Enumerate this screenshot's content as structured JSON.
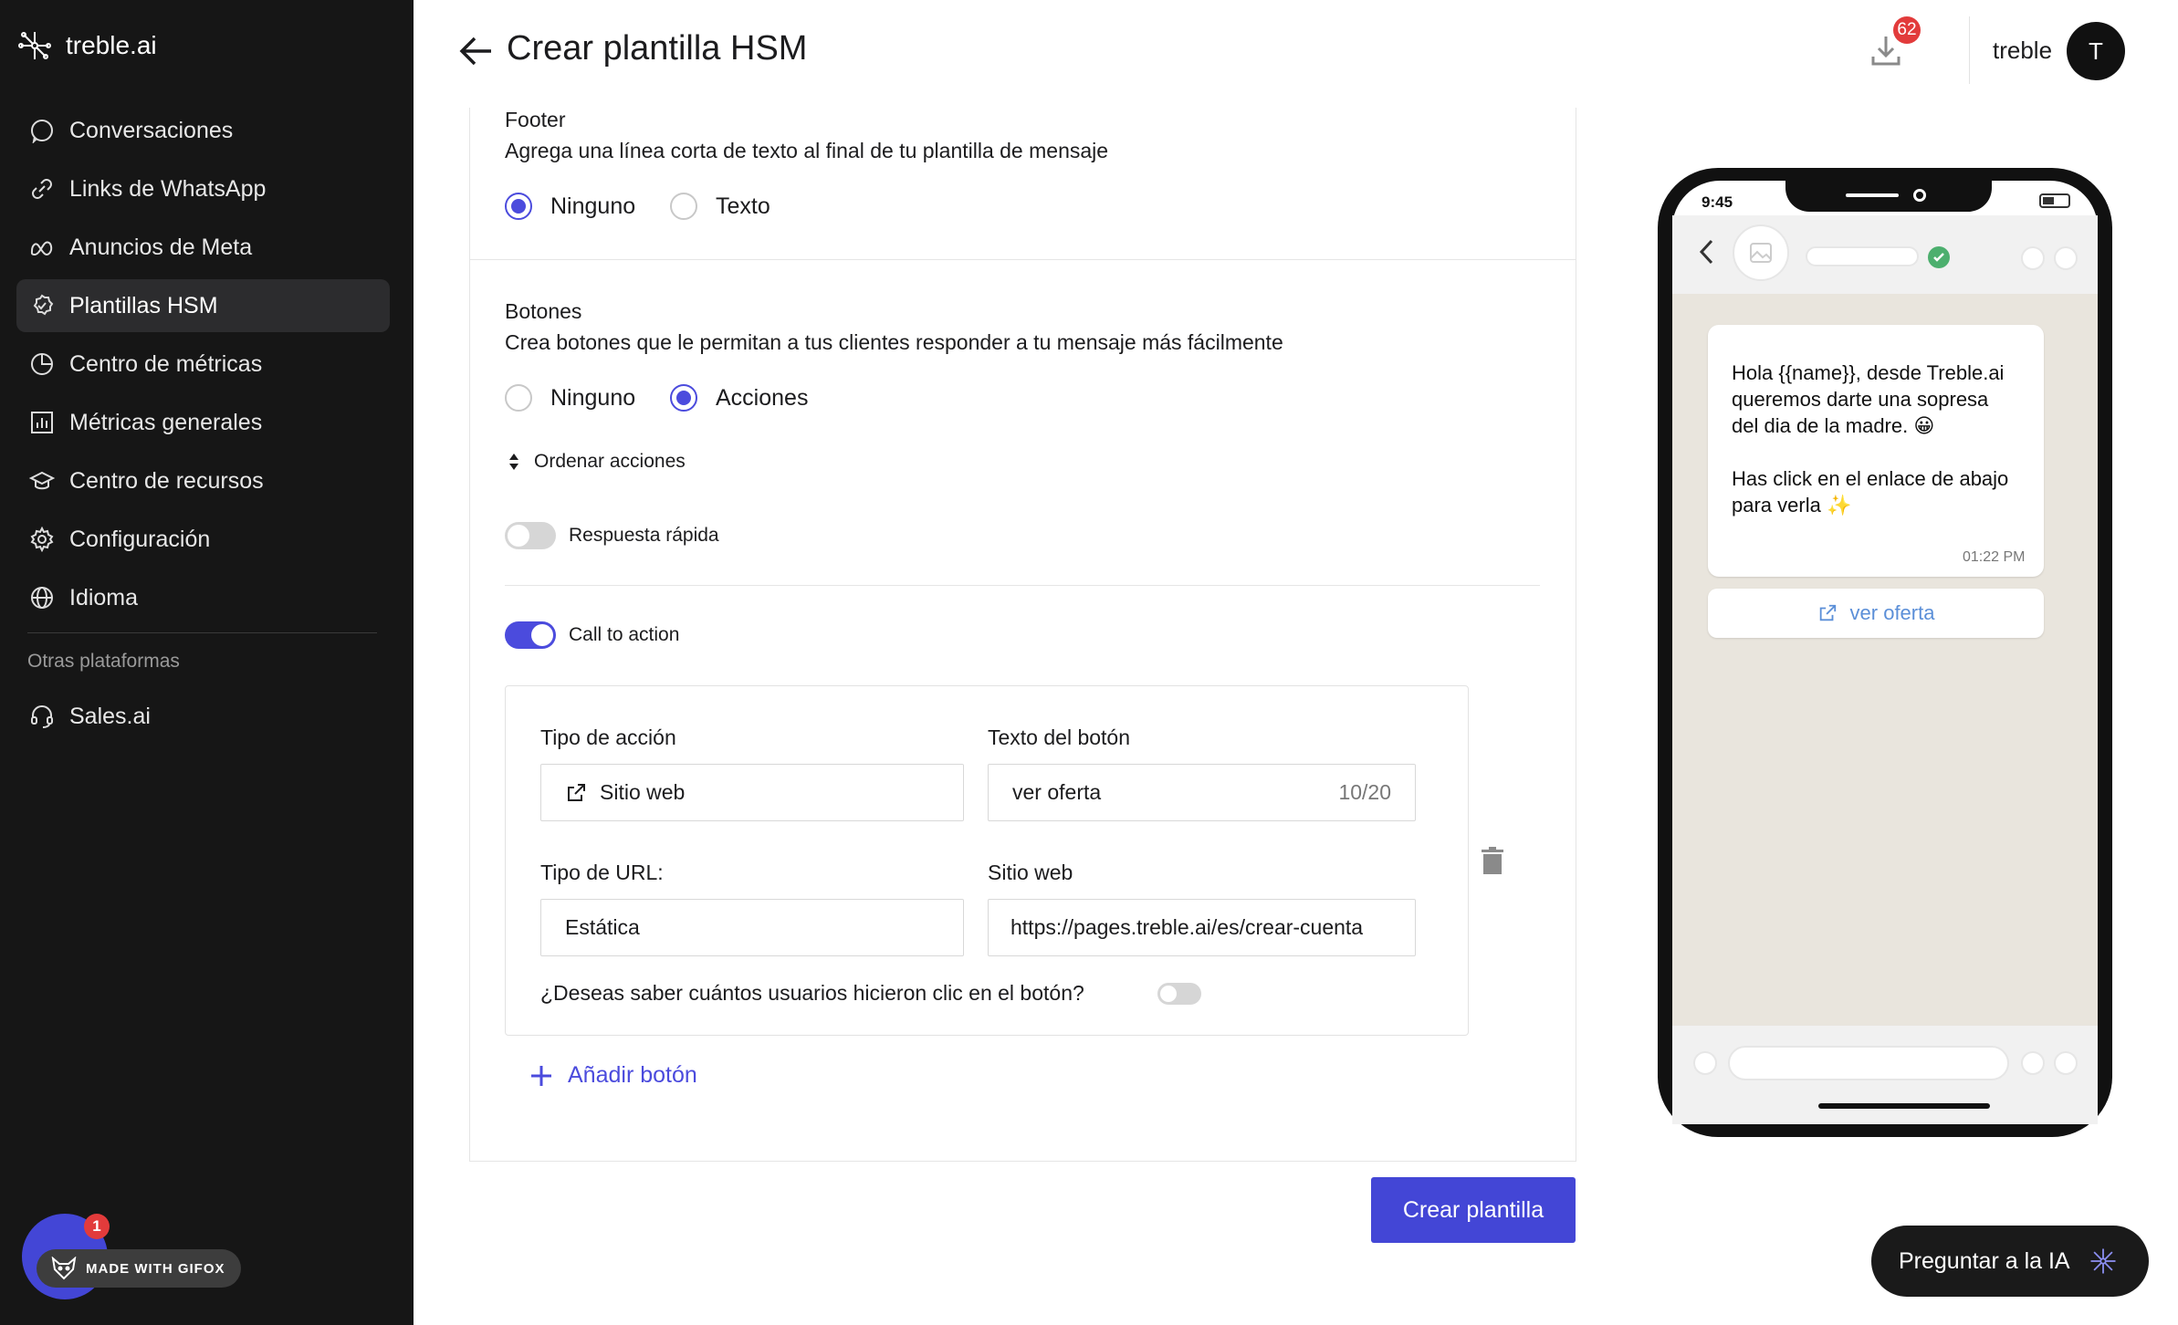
{
  "app": {
    "logo_text": "treble.ai",
    "page_title": "Crear plantilla HSM"
  },
  "header": {
    "downloads_badge": "62",
    "user_name": "treble",
    "avatar_initial": "T"
  },
  "sidebar": {
    "items": [
      {
        "label": "Conversaciones",
        "icon": "chat-icon"
      },
      {
        "label": "Links de WhatsApp",
        "icon": "link-icon"
      },
      {
        "label": "Anuncios de Meta",
        "icon": "meta-icon"
      },
      {
        "label": "Plantillas HSM",
        "icon": "template-check-icon",
        "active": true
      },
      {
        "label": "Centro de métricas",
        "icon": "pie-chart-icon"
      },
      {
        "label": "Métricas generales",
        "icon": "bar-chart-icon"
      },
      {
        "label": "Centro de recursos",
        "icon": "graduation-cap-icon"
      },
      {
        "label": "Configuración",
        "icon": "gear-icon"
      },
      {
        "label": "Idioma",
        "icon": "globe-icon"
      }
    ],
    "section_label": "Otras plataformas",
    "other_items": [
      {
        "label": "Sales.ai",
        "icon": "headset-icon"
      }
    ]
  },
  "gifox": {
    "badge": "1",
    "label": "MADE WITH GIFOX"
  },
  "form": {
    "footer": {
      "title": "Footer",
      "description": "Agrega una línea corta de texto al final de tu plantilla de mensaje",
      "options": [
        "Ninguno",
        "Texto"
      ],
      "selected": "Ninguno"
    },
    "buttons": {
      "title": "Botones",
      "description": "Crea botones que le permitan a tus clientes responder a tu mensaje más fácilmente",
      "options": [
        "Ninguno",
        "Acciones"
      ],
      "selected": "Acciones",
      "order_label": "Ordenar acciones",
      "quick_reply_label": "Respuesta rápida",
      "quick_reply_on": false,
      "cta_label": "Call to action",
      "cta_on": true
    },
    "cta": {
      "action_type_label": "Tipo de acción",
      "action_type_value": "Sitio web",
      "button_text_label": "Texto del botón",
      "button_text_value": "ver oferta",
      "button_text_counter": "10/20",
      "url_type_label": "Tipo de URL:",
      "url_type_value": "Estática",
      "website_label": "Sitio web",
      "website_value": "https://pages.treble.ai/es/crear-cuenta",
      "track_question": "¿Deseas saber cuántos usuarios hicieron clic en el botón?",
      "track_on": false
    },
    "add_button_label": "Añadir botón",
    "submit_label": "Crear plantilla"
  },
  "preview": {
    "time": "9:45",
    "message_line1": "Hola {{name}}, desde Treble.ai queremos darte una sopresa del dia de la madre. 😀",
    "message_line2": "Has click en el enlace de abajo para verla ✨",
    "message_time": "01:22 PM",
    "link_button": "ver oferta"
  },
  "ask_ai": {
    "label": "Preguntar a la IA"
  },
  "colors": {
    "accent": "#4346d6",
    "sidebar_bg": "#161616",
    "badge": "#e23b3b",
    "link": "#5b8fd8"
  }
}
